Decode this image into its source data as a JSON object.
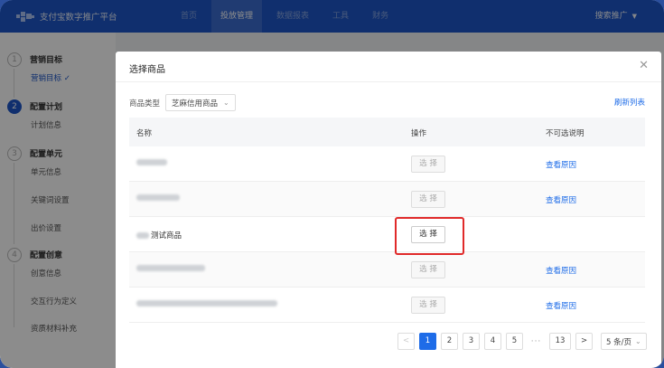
{
  "brand": {
    "name": "支付宝数字推广平台"
  },
  "nav": {
    "items": [
      {
        "label": "首页",
        "active": false
      },
      {
        "label": "投放管理",
        "active": true
      },
      {
        "label": "数据报表",
        "active": false
      },
      {
        "label": "工具",
        "active": false
      },
      {
        "label": "财务",
        "active": false
      }
    ],
    "right_label": "搜索推广"
  },
  "steps": [
    {
      "num": "1",
      "title": "营销目标",
      "subs": [
        "营销目标 ✓"
      ],
      "active": false
    },
    {
      "num": "2",
      "title": "配置计划",
      "subs": [
        "计划信息"
      ],
      "active": true
    },
    {
      "num": "3",
      "title": "配置单元",
      "subs": [
        "单元信息",
        "关键词设置",
        "出价设置"
      ],
      "active": false
    },
    {
      "num": "4",
      "title": "配置创意",
      "subs": [
        "创意信息",
        "交互行为定义",
        "资质材料补充"
      ],
      "active": false
    }
  ],
  "modal": {
    "title": "选择商品",
    "filter_label": "商品类型",
    "filter_value": "芝麻信用商品",
    "refresh_label": "刷新列表",
    "columns": {
      "name": "名称",
      "action": "操作",
      "note": "不可选说明"
    },
    "rows": [
      {
        "name_suffix": "",
        "select_label": "选 择",
        "enabled": false,
        "reason": "查看原因"
      },
      {
        "name_suffix": "",
        "select_label": "选 择",
        "enabled": false,
        "reason": "查看原因"
      },
      {
        "name_suffix": "测试商品",
        "select_label": "选 择",
        "enabled": true,
        "reason": ""
      },
      {
        "name_suffix": "",
        "select_label": "选 择",
        "enabled": false,
        "reason": "查看原因"
      },
      {
        "name_suffix": "",
        "select_label": "选 择",
        "enabled": false,
        "reason": "查看原因"
      }
    ],
    "pagination": {
      "prev": "<",
      "pages": [
        "1",
        "2",
        "3",
        "4",
        "5"
      ],
      "current": "1",
      "ellipsis": "···",
      "last": "13",
      "next": ">",
      "page_size": "5 条/页"
    }
  },
  "colors": {
    "primary": "#1e57c9",
    "link": "#1e6ce8",
    "highlight": "#e02a2a"
  }
}
